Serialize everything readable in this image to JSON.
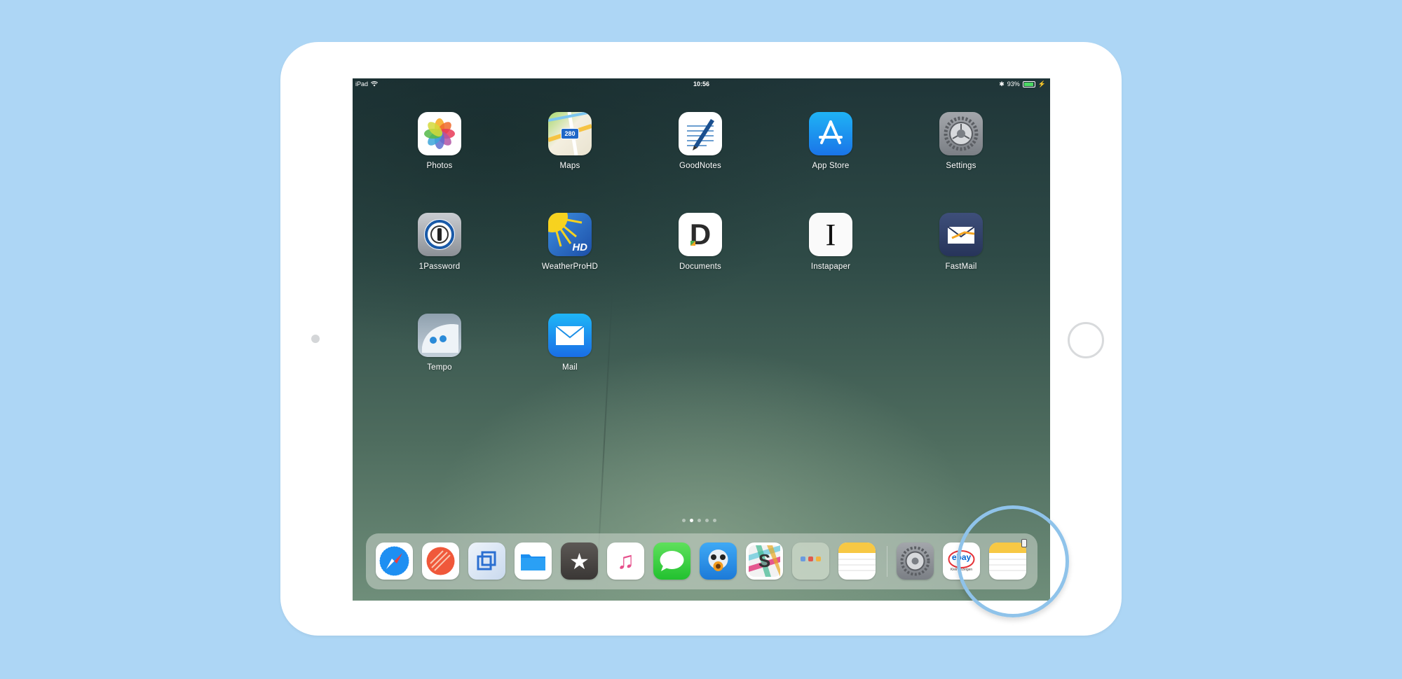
{
  "status_bar": {
    "device": "iPad",
    "time": "10:56",
    "battery_percent": "93%",
    "battery_level": 0.93,
    "icons": [
      "wifi-icon",
      "bluetooth-icon",
      "battery-icon",
      "charging-icon"
    ]
  },
  "home_apps": [
    {
      "label": "Photos",
      "icon": "photos-icon"
    },
    {
      "label": "Maps",
      "icon": "maps-icon",
      "badge": "280"
    },
    {
      "label": "GoodNotes",
      "icon": "goodnotes-icon"
    },
    {
      "label": "App Store",
      "icon": "app-store-icon"
    },
    {
      "label": "Settings",
      "icon": "settings-icon"
    },
    {
      "label": "1Password",
      "icon": "1password-icon"
    },
    {
      "label": "WeatherProHD",
      "icon": "weatherpro-icon",
      "badge": "HD"
    },
    {
      "label": "Documents",
      "icon": "documents-icon",
      "badge": "D"
    },
    {
      "label": "Instapaper",
      "icon": "instapaper-icon",
      "badge": "I"
    },
    {
      "label": "FastMail",
      "icon": "fastmail-icon"
    },
    {
      "label": "Tempo",
      "icon": "tempo-icon"
    },
    {
      "label": "Mail",
      "icon": "mail-icon"
    }
  ],
  "page_indicator": {
    "count": 5,
    "active_index": 1
  },
  "dock": {
    "apps": [
      {
        "icon": "safari-icon"
      },
      {
        "icon": "screens-icon"
      },
      {
        "icon": "copied-icon"
      },
      {
        "icon": "files-icon"
      },
      {
        "icon": "reeder-star-icon",
        "glyph": "★"
      },
      {
        "icon": "music-icon",
        "glyph": "♫"
      },
      {
        "icon": "messages-icon"
      },
      {
        "icon": "tweetbot-icon"
      },
      {
        "icon": "slack-icon",
        "glyph": "S"
      },
      {
        "icon": "folder-icon"
      },
      {
        "icon": "notes-icon"
      }
    ],
    "recent_apps": [
      {
        "icon": "settings-icon"
      },
      {
        "icon": "ebay-kleinanzeigen-icon",
        "text": "ebay",
        "subtext": "Kleinanzeigen"
      },
      {
        "icon": "notes-icon",
        "highlighted": true
      }
    ]
  },
  "colors": {
    "background": "#add6f5",
    "device_frame": "#ffffff",
    "highlight_ring": "#8fc3ea"
  }
}
